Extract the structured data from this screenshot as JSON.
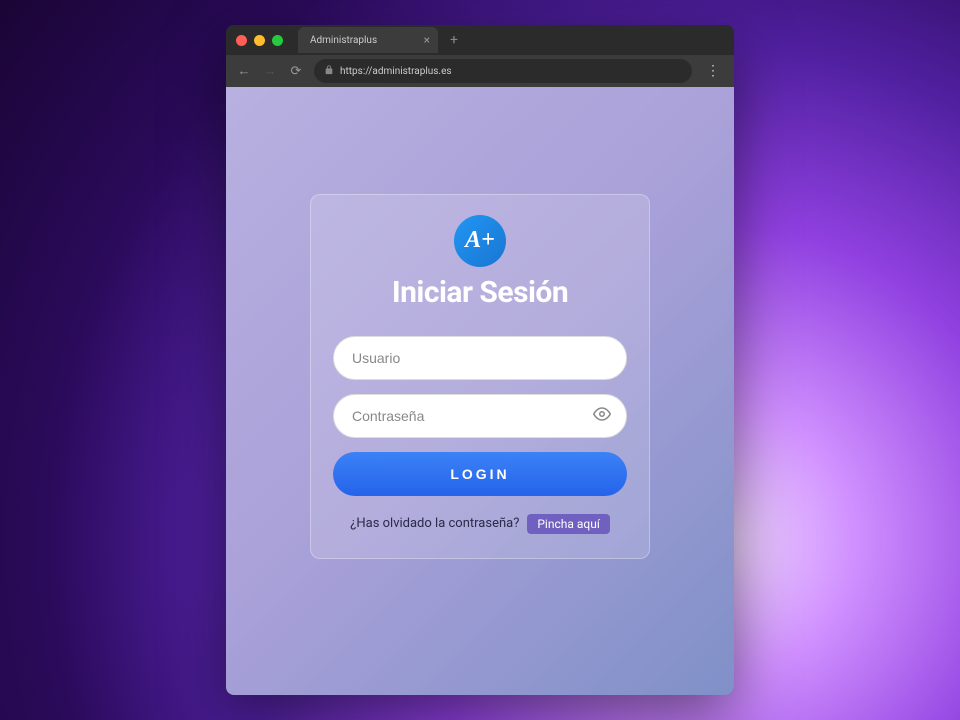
{
  "browser": {
    "tab_title": "Administraplus",
    "url": "https://administraplus.es"
  },
  "login": {
    "logo_text": "A+",
    "title": "Iniciar Sesión",
    "username_placeholder": "Usuario",
    "password_placeholder": "Contraseña",
    "button_label": "LOGIN",
    "forgot_text": "¿Has olvidado la contraseña?",
    "forgot_link": "Pincha aquí"
  },
  "colors": {
    "primary_blue": "#2563eb",
    "logo_blue": "#2196f3",
    "link_purple": "#7060c0"
  }
}
